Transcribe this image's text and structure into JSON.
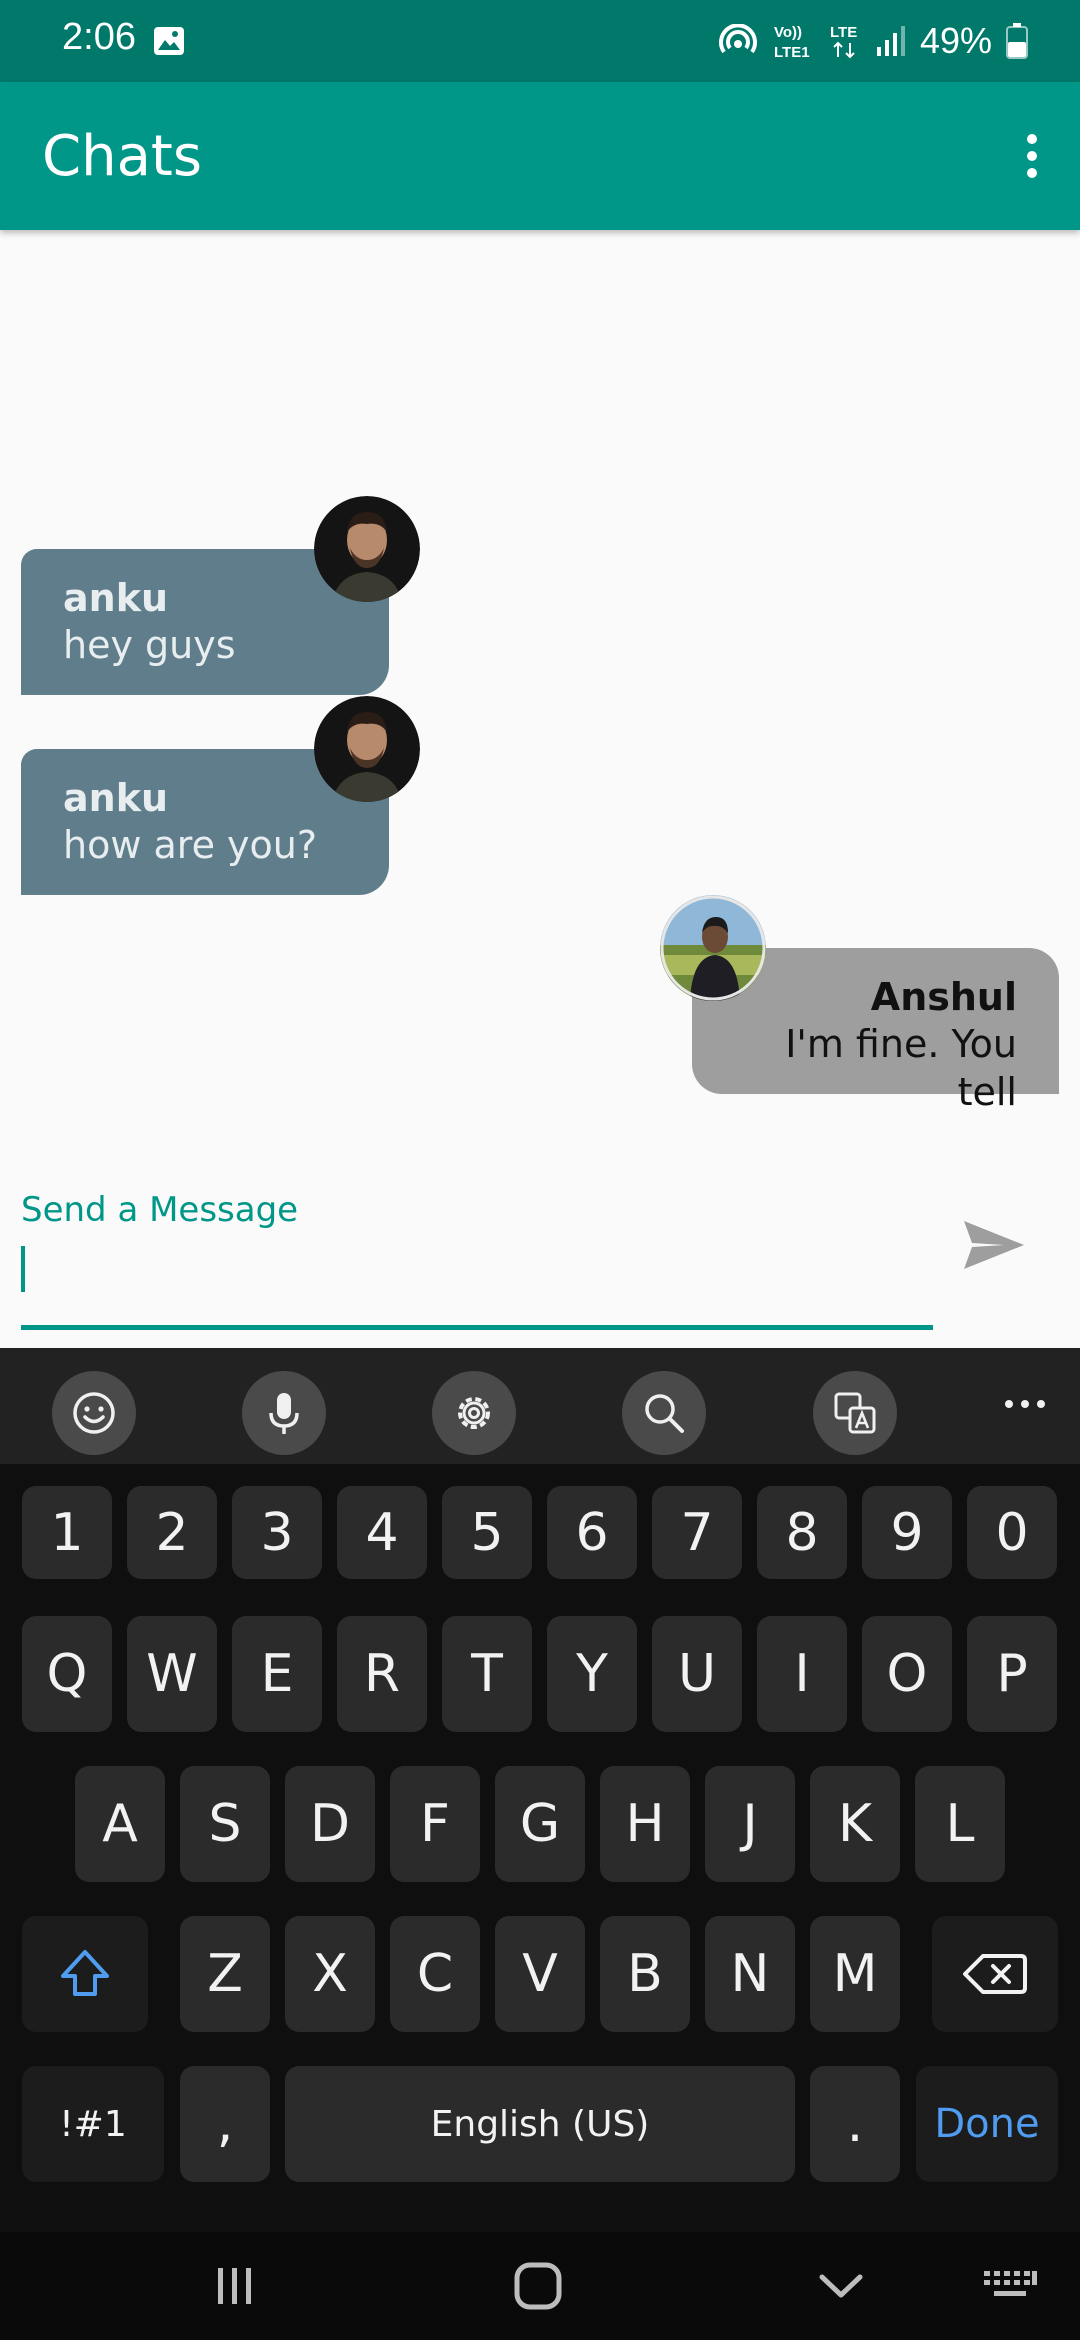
{
  "status_bar": {
    "time": "2:06",
    "network_labels": [
      "Vo))",
      "LTE1",
      "LTE"
    ],
    "battery": "49%"
  },
  "app_bar": {
    "title": "Chats"
  },
  "messages": [
    {
      "sender": "anku",
      "text": "hey guys",
      "direction": "incoming"
    },
    {
      "sender": "anku",
      "text": "how are you?",
      "direction": "incoming"
    },
    {
      "sender": "Anshul",
      "text": "I'm fine. You tell",
      "direction": "outgoing"
    }
  ],
  "composer": {
    "label": "Send a Message",
    "value": ""
  },
  "keyboard": {
    "toolbar": [
      "emoji-icon",
      "microphone-icon",
      "settings-icon",
      "search-icon",
      "translate-icon",
      "more-icon"
    ],
    "row_numbers": [
      "1",
      "2",
      "3",
      "4",
      "5",
      "6",
      "7",
      "8",
      "9",
      "0"
    ],
    "row_top": [
      "Q",
      "W",
      "E",
      "R",
      "T",
      "Y",
      "U",
      "I",
      "O",
      "P"
    ],
    "row_middle": [
      "A",
      "S",
      "D",
      "F",
      "G",
      "H",
      "J",
      "K",
      "L"
    ],
    "row_bottom": [
      "Z",
      "X",
      "C",
      "V",
      "B",
      "N",
      "M"
    ],
    "symbols_key": "!#1",
    "comma_key": ",",
    "space_key": "English (US)",
    "period_key": ".",
    "done_key": "Done"
  },
  "colors": {
    "primary": "#009688",
    "primary_dark": "#00796b",
    "incoming_bubble": "#607d8b",
    "outgoing_bubble": "#9e9e9e",
    "keyboard_accent": "#4f9cf0"
  }
}
